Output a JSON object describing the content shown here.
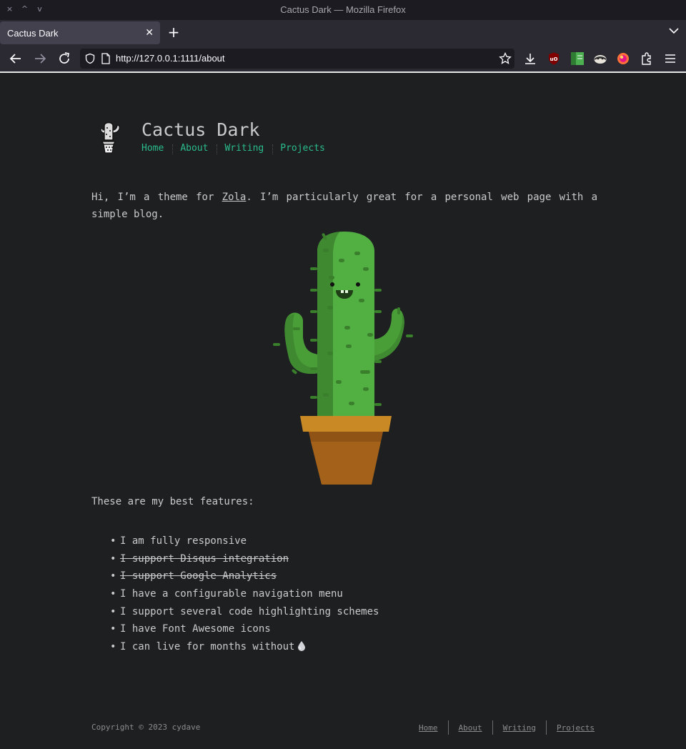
{
  "window": {
    "title": "Cactus Dark — Mozilla Firefox",
    "controls": [
      "×",
      "^",
      "v"
    ]
  },
  "tabs": [
    {
      "title": "Cactus Dark",
      "active": true
    }
  ],
  "toolbar": {
    "url": "http://127.0.0.1:1111/about",
    "extensions": [
      "ublock-origin-icon",
      "sidebar-green-icon",
      "privacy-badger-icon",
      "firefox-color-icon"
    ]
  },
  "site": {
    "title": "Cactus Dark",
    "nav": [
      "Home",
      "About",
      "Writing",
      "Projects"
    ]
  },
  "intro": {
    "before_link": "Hi, I’m a theme for ",
    "link": "Zola",
    "after_link": ". I’m particularly great for a personal web page with a simple blog."
  },
  "features_heading": "These are my best features:",
  "features": [
    {
      "text": "I am fully responsive",
      "struck": false
    },
    {
      "text": "I support Disqus integration",
      "struck": true
    },
    {
      "text": "I support Google Analytics",
      "struck": true
    },
    {
      "text": "I have a configurable navigation menu",
      "struck": false
    },
    {
      "text": "I support several code highlighting schemes",
      "struck": false
    },
    {
      "text": "I have Font Awesome icons",
      "struck": false
    },
    {
      "text": "I can live for months without",
      "struck": false
    }
  ],
  "footer": {
    "copyright": "Copyright © 2023 cydave",
    "nav": [
      "Home",
      "About",
      "Writing",
      "Projects"
    ]
  },
  "colors": {
    "background": "#1d1f21",
    "text": "#c9cacc",
    "accent": "#2bbc8a",
    "browser_chrome": "#2b2a33"
  }
}
